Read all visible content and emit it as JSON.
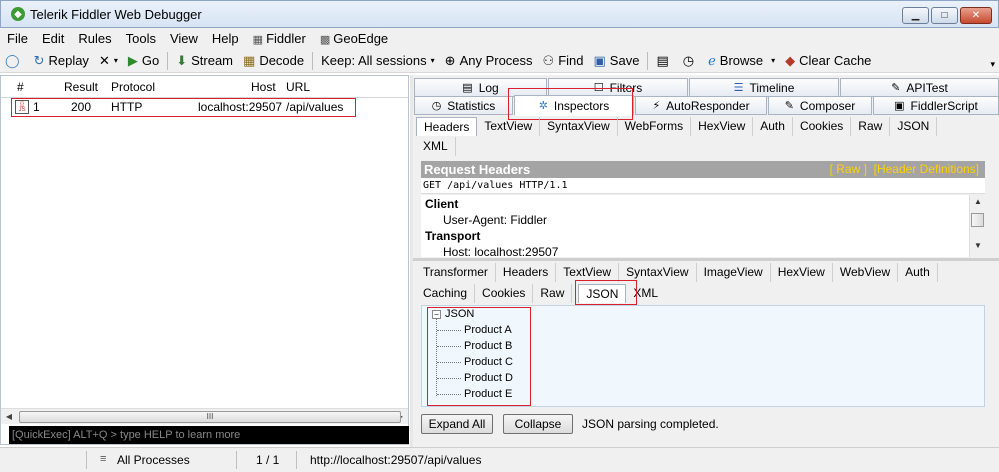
{
  "window": {
    "title": "Telerik Fiddler Web Debugger",
    "minimize": "▁",
    "maximize": "□",
    "close": "✕"
  },
  "menu": {
    "items": [
      "File",
      "Edit",
      "Rules",
      "Tools",
      "View",
      "Help"
    ],
    "fiddler": "Fiddler",
    "geoedge": "GeoEdge"
  },
  "toolbar": {
    "replay": "Replay",
    "go": "Go",
    "stream": "Stream",
    "decode": "Decode",
    "keep": "Keep: All sessions",
    "any_process": "Any Process",
    "find": "Find",
    "save": "Save",
    "browse": "Browse",
    "clear_cache": "Clear Cache"
  },
  "sessions": {
    "columns": [
      "#",
      "Result",
      "Protocol",
      "Host",
      "URL"
    ],
    "rows": [
      {
        "num": "1",
        "result": "200",
        "protocol": "HTTP",
        "host": "localhost:29507",
        "url": "/api/values"
      }
    ],
    "scroll_grip": "III",
    "quickexec_placeholder": "[QuickExec] ALT+Q > type HELP to learn more"
  },
  "inspector_tabs": {
    "row1": [
      "Log",
      "Filters",
      "Timeline",
      "APITest"
    ],
    "row2": [
      "Statistics",
      "Inspectors",
      "AutoResponder",
      "Composer",
      "FiddlerScript"
    ]
  },
  "request": {
    "tabs": [
      "Headers",
      "TextView",
      "SyntaxView",
      "WebForms",
      "HexView",
      "Auth",
      "Cookies",
      "Raw",
      "JSON"
    ],
    "tabs2": [
      "XML"
    ],
    "header_title": "Request Headers",
    "raw_link": "[ Raw ]",
    "defs_link": "[Header Definitions]",
    "request_line": "GET /api/values HTTP/1.1",
    "groups": [
      {
        "name": "Client",
        "item": "User-Agent: Fiddler"
      },
      {
        "name": "Transport",
        "item": "Host: localhost:29507"
      }
    ]
  },
  "response": {
    "tabs": [
      "Transformer",
      "Headers",
      "TextView",
      "SyntaxView",
      "ImageView",
      "HexView",
      "WebView",
      "Auth"
    ],
    "tabs2": [
      "Caching",
      "Cookies",
      "Raw",
      "JSON",
      "XML"
    ],
    "tree_root": "JSON",
    "tree_items": [
      "Product A",
      "Product B",
      "Product C",
      "Product D",
      "Product E"
    ],
    "expand_all": "Expand All",
    "collapse": "Collapse",
    "status": "JSON parsing completed."
  },
  "statusbar": {
    "processes": "All Processes",
    "count": "1 / 1",
    "url": "http://localhost:29507/api/values"
  },
  "colors": {
    "highlight": "#d9212b",
    "title_bar": "#d7e4f4",
    "quickexec_bg": "#000000"
  }
}
